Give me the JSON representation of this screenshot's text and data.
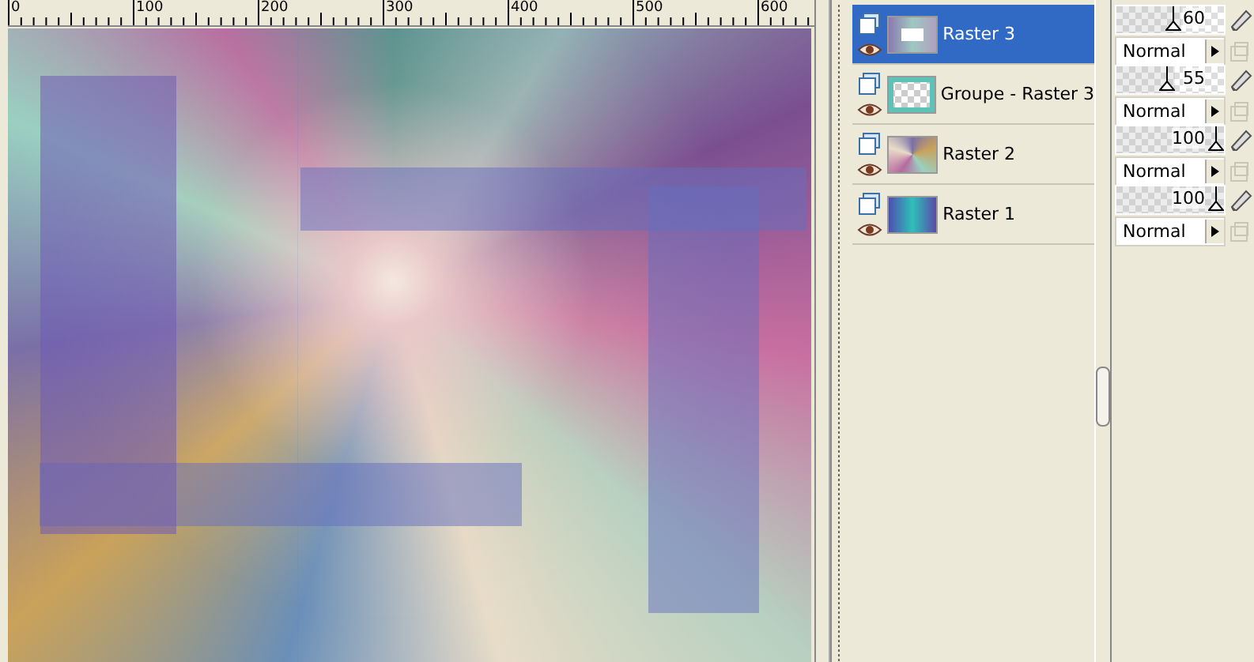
{
  "ruler": {
    "labels": [
      "0",
      "100",
      "200",
      "300",
      "400",
      "500",
      "600"
    ]
  },
  "layers": [
    {
      "name": "Raster 3",
      "selected": true,
      "opacity": "60",
      "level": 0.6,
      "blend_mode": "Normal"
    },
    {
      "name": "Groupe - Raster 3",
      "selected": false,
      "opacity": "55",
      "level": 0.55,
      "blend_mode": "Normal"
    },
    {
      "name": "Raster 2",
      "selected": false,
      "opacity": "100",
      "level": 1,
      "blend_mode": "Normal"
    },
    {
      "name": "Raster 1",
      "selected": false,
      "opacity": "100",
      "level": 1,
      "blend_mode": "Normal"
    }
  ]
}
